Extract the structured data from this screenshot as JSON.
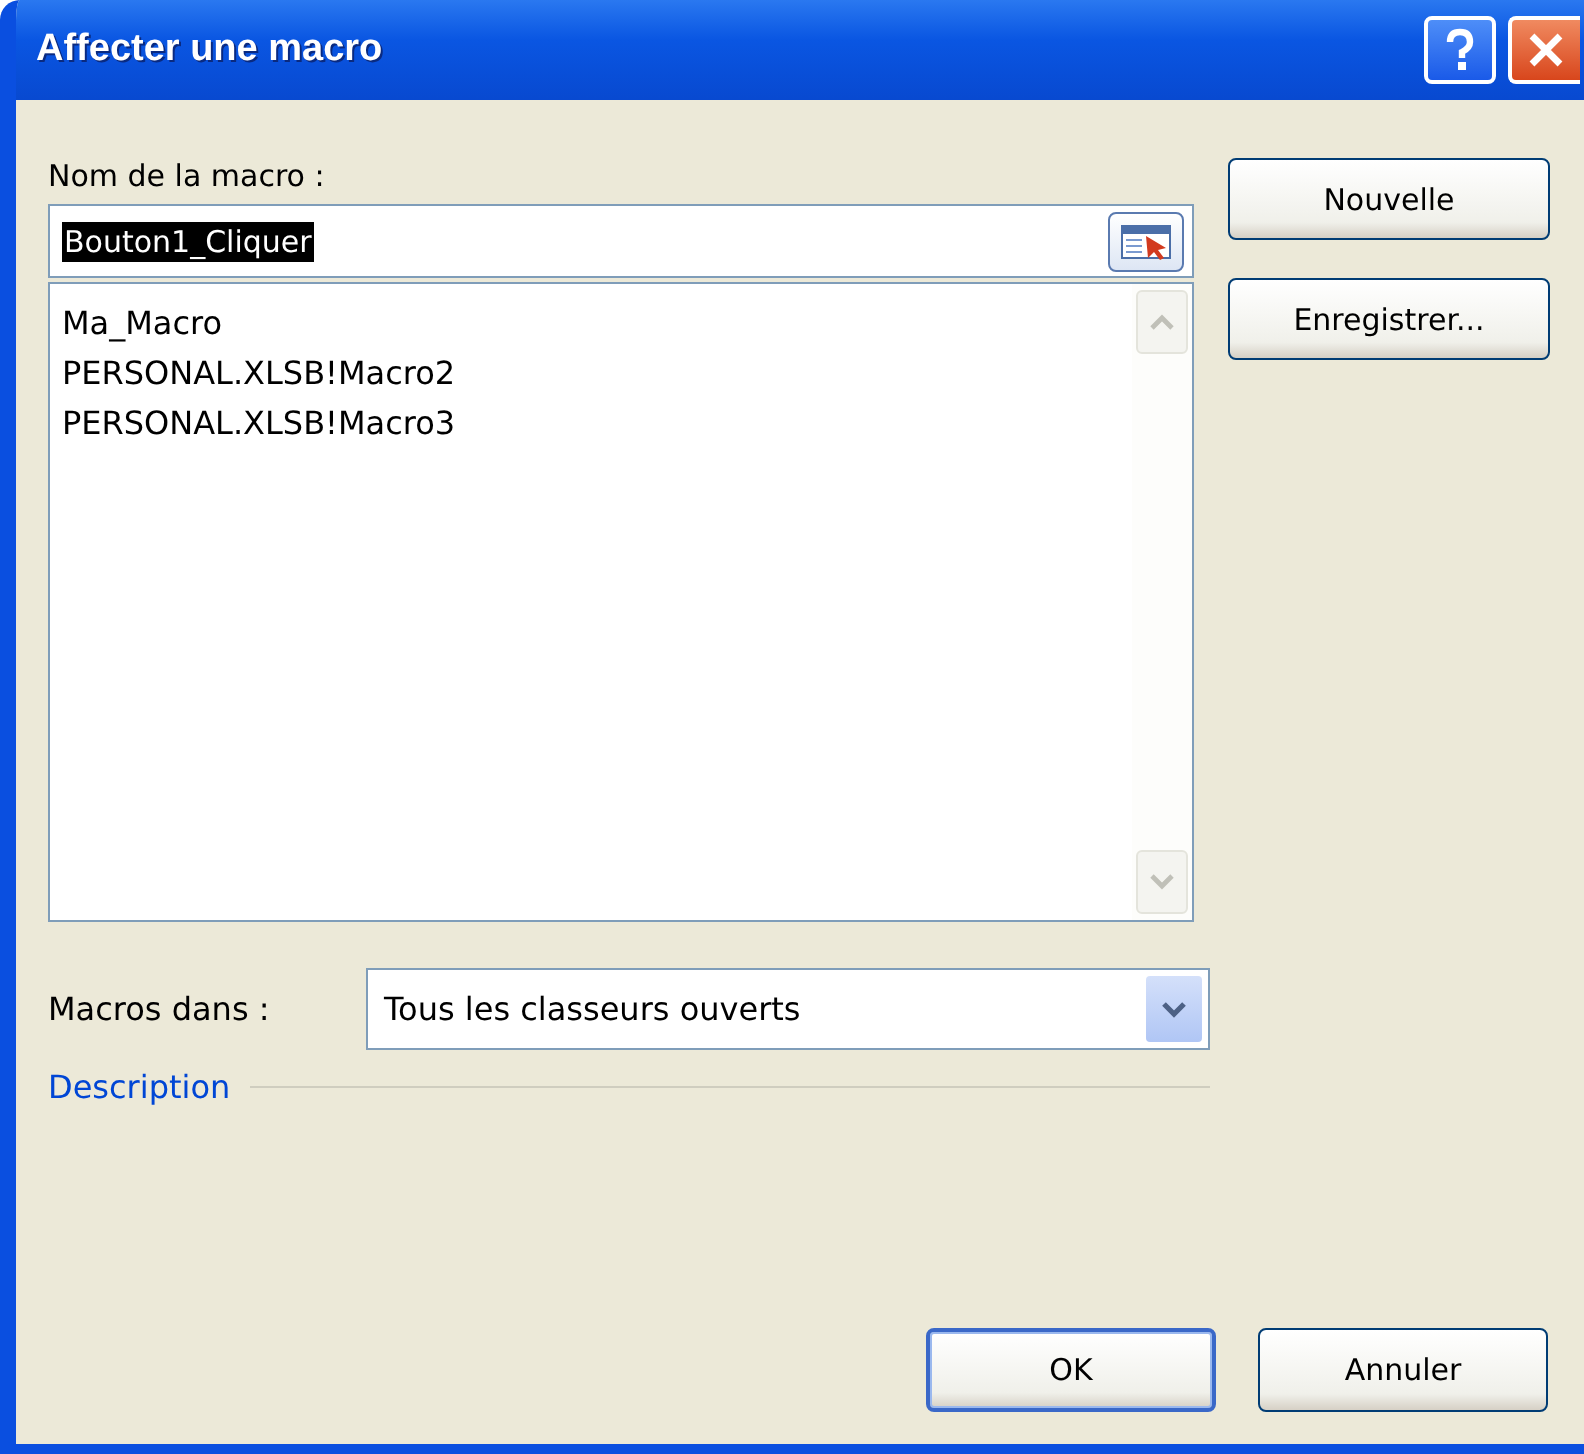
{
  "window": {
    "title": "Affecter une macro"
  },
  "macro_name": {
    "label": "Nom de la macro :",
    "value": "Bouton1_Cliquer"
  },
  "macros": [
    {
      "name": "Ma_Macro",
      "selected": false
    },
    {
      "name": "PERSONAL.XLSB!Macro2",
      "selected": false
    },
    {
      "name": "PERSONAL.XLSB!Macro3",
      "selected": false
    }
  ],
  "side_buttons": [
    "Nouvelle",
    "Enregistrer..."
  ],
  "macros_in": {
    "label": "Macros dans :",
    "value": "Tous les classeurs ouverts"
  },
  "description": {
    "label": "Description"
  },
  "buttons": [
    "OK",
    "Annuler"
  ]
}
